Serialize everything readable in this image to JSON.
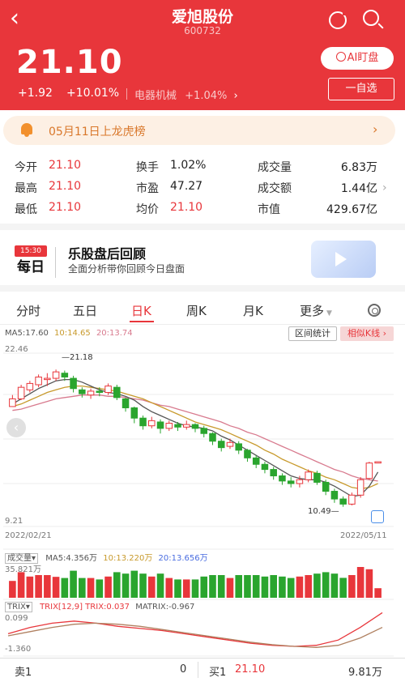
{
  "header": {
    "title": "爱旭股份",
    "code": "600732",
    "price": "21.10",
    "change": "+1.92",
    "change_pct": "+10.01%",
    "industry": "电器机械",
    "industry_change": "+1.04%",
    "ai_button": "AI盯盘",
    "watch_button": "一自选",
    "icons": [
      "back-icon",
      "refresh-icon",
      "search-icon"
    ]
  },
  "notice": {
    "text": "05月11日上龙虎榜",
    "arrow": "›"
  },
  "quote": {
    "rows": [
      [
        {
          "label": "今开",
          "value": "21.10"
        },
        {
          "label": "换手",
          "value": "1.02%"
        },
        {
          "label": "成交量",
          "value": "6.83万"
        }
      ],
      [
        {
          "label": "最高",
          "value": "21.10"
        },
        {
          "label": "市盈",
          "value": "47.27"
        },
        {
          "label": "成交额",
          "value": "1.44亿"
        }
      ],
      [
        {
          "label": "最低",
          "value": "21.10"
        },
        {
          "label": "均价",
          "value": "21.10"
        },
        {
          "label": "市值",
          "value": "429.67亿"
        }
      ]
    ]
  },
  "promo": {
    "badge_top": "15:30",
    "badge_bottom": "每日",
    "title": "乐股盘后回顾",
    "subtitle": "全面分析带你回顾今日盘面"
  },
  "tabs": [
    "分时",
    "五日",
    "日K",
    "周K",
    "月K",
    "更多"
  ],
  "active_tab": "日K",
  "kline": {
    "ma_legend": {
      "ma5": "MA5:17.60",
      "ma10": "10:14.65",
      "ma20": "20:13.74"
    },
    "interval_stat": "区间统计",
    "similar_kline": "相似K线 ›",
    "y_max": "22.46",
    "y_min": "9.21",
    "high_label": "21.18",
    "low_label": "10.49",
    "date_start": "2022/02/21",
    "date_end": "2022/05/11"
  },
  "volume": {
    "selector": "成交量",
    "ma5": "MA5:4.356万",
    "ma10": "10:13.220万",
    "ma20": "20:13.656万",
    "y_max": "35.821万"
  },
  "trix": {
    "selector": "TRIX",
    "trix": "TRIX[12,9] TRIX:0.037",
    "matrix": "MATRIX:-0.967",
    "y_max": "0.099",
    "y_min": "-1.360"
  },
  "order_book": {
    "sell1_label": "卖1",
    "sell1_value": "0",
    "buy1_label": "买1",
    "buy1_price": "21.10",
    "buy1_volume": "9.81万"
  },
  "colors": {
    "up": "#e8363b",
    "down": "#2aa52e",
    "ma5": "#555555",
    "ma10": "#c89a2c",
    "ma20": "#d87a8e"
  },
  "chart_data": {
    "type": "candlestick",
    "x_start": "2022/02/21",
    "x_end": "2022/05/11",
    "ylim": [
      9.21,
      22.46
    ],
    "candles": [
      [
        18.3,
        18.9,
        18.6,
        19.2
      ],
      [
        18.9,
        19.8,
        18.8,
        20.0
      ],
      [
        19.6,
        20.1,
        19.4,
        20.3
      ],
      [
        20.0,
        20.6,
        19.8,
        20.8
      ],
      [
        20.4,
        20.5,
        19.9,
        20.9
      ],
      [
        20.5,
        21.0,
        20.3,
        21.18
      ],
      [
        20.9,
        20.6,
        20.3,
        21.1
      ],
      [
        20.5,
        19.7,
        19.4,
        20.7
      ],
      [
        19.6,
        19.3,
        19.0,
        19.8
      ],
      [
        19.2,
        19.5,
        18.9,
        19.7
      ],
      [
        19.5,
        19.4,
        19.1,
        19.8
      ],
      [
        19.4,
        19.9,
        19.2,
        20.1
      ],
      [
        19.8,
        19.0,
        18.8,
        20.0
      ],
      [
        18.9,
        18.2,
        17.9,
        19.0
      ],
      [
        18.2,
        17.4,
        17.0,
        18.3
      ],
      [
        17.4,
        16.8,
        16.5,
        17.6
      ],
      [
        16.8,
        17.2,
        16.6,
        17.5
      ],
      [
        17.1,
        16.6,
        16.2,
        17.3
      ],
      [
        16.6,
        17.0,
        16.4,
        17.2
      ],
      [
        16.9,
        16.7,
        16.4,
        17.1
      ],
      [
        16.7,
        16.9,
        16.5,
        17.2
      ],
      [
        16.9,
        16.6,
        16.3,
        17.0
      ],
      [
        16.6,
        16.2,
        15.9,
        16.8
      ],
      [
        16.2,
        15.6,
        15.3,
        16.3
      ],
      [
        15.6,
        15.1,
        14.8,
        15.8
      ],
      [
        15.2,
        15.5,
        15.0,
        15.8
      ],
      [
        15.4,
        14.9,
        14.6,
        15.6
      ],
      [
        14.9,
        14.3,
        14.0,
        15.0
      ],
      [
        14.3,
        13.8,
        13.5,
        14.5
      ],
      [
        13.8,
        13.4,
        13.1,
        14.0
      ],
      [
        13.4,
        12.9,
        12.6,
        13.6
      ],
      [
        12.9,
        12.5,
        12.2,
        13.1
      ],
      [
        12.5,
        12.3,
        12.0,
        12.8
      ],
      [
        12.3,
        12.6,
        12.0,
        12.9
      ],
      [
        12.6,
        13.2,
        12.4,
        13.4
      ],
      [
        13.1,
        12.4,
        12.2,
        13.3
      ],
      [
        12.4,
        11.7,
        11.4,
        12.6
      ],
      [
        11.7,
        11.1,
        10.8,
        11.9
      ],
      [
        11.1,
        10.7,
        10.49,
        11.3
      ],
      [
        10.7,
        11.4,
        10.6,
        11.6
      ],
      [
        11.4,
        12.6,
        11.2,
        12.8
      ],
      [
        12.7,
        13.9,
        12.6,
        14.0
      ],
      [
        13.9,
        14.0,
        13.9,
        14.0
      ]
    ],
    "ma5": [
      18.5,
      18.9,
      19.3,
      19.7,
      20.0,
      20.3,
      20.4,
      20.4,
      20.2,
      19.9,
      19.6,
      19.4,
      19.3,
      19.1,
      18.8,
      18.3,
      17.9,
      17.6,
      17.3,
      17.0,
      16.8,
      16.7,
      16.6,
      16.4,
      16.0,
      15.7,
      15.3,
      14.9,
      14.5,
      14.1,
      13.7,
      13.3,
      12.9,
      12.7,
      12.6,
      12.6,
      12.4,
      12.1,
      11.7,
      11.3,
      11.4,
      12.1,
      13.2
    ],
    "ma10": [
      18.3,
      18.5,
      18.8,
      19.1,
      19.4,
      19.6,
      19.8,
      19.9,
      19.9,
      19.8,
      19.7,
      19.6,
      19.5,
      19.3,
      19.1,
      18.9,
      18.6,
      18.3,
      18.0,
      17.7,
      17.4,
      17.1,
      16.9,
      16.7,
      16.5,
      16.2,
      15.9,
      15.6,
      15.3,
      14.9,
      14.6,
      14.2,
      13.9,
      13.6,
      13.3,
      13.1,
      12.8,
      12.6,
      12.3,
      12.0,
      11.9,
      12.0,
      12.3
    ],
    "ma20": [
      18.0,
      18.1,
      18.3,
      18.5,
      18.7,
      18.9,
      19.0,
      19.1,
      19.2,
      19.2,
      19.2,
      19.1,
      19.1,
      19.0,
      18.9,
      18.8,
      18.6,
      18.4,
      18.3,
      18.1,
      17.9,
      17.7,
      17.5,
      17.3,
      17.1,
      16.8,
      16.6,
      16.3,
      16.1,
      15.8,
      15.5,
      15.2,
      14.9,
      14.6,
      14.3,
      14.0,
      13.7,
      13.4,
      13.2,
      12.9,
      12.7,
      12.6,
      12.5
    ]
  }
}
